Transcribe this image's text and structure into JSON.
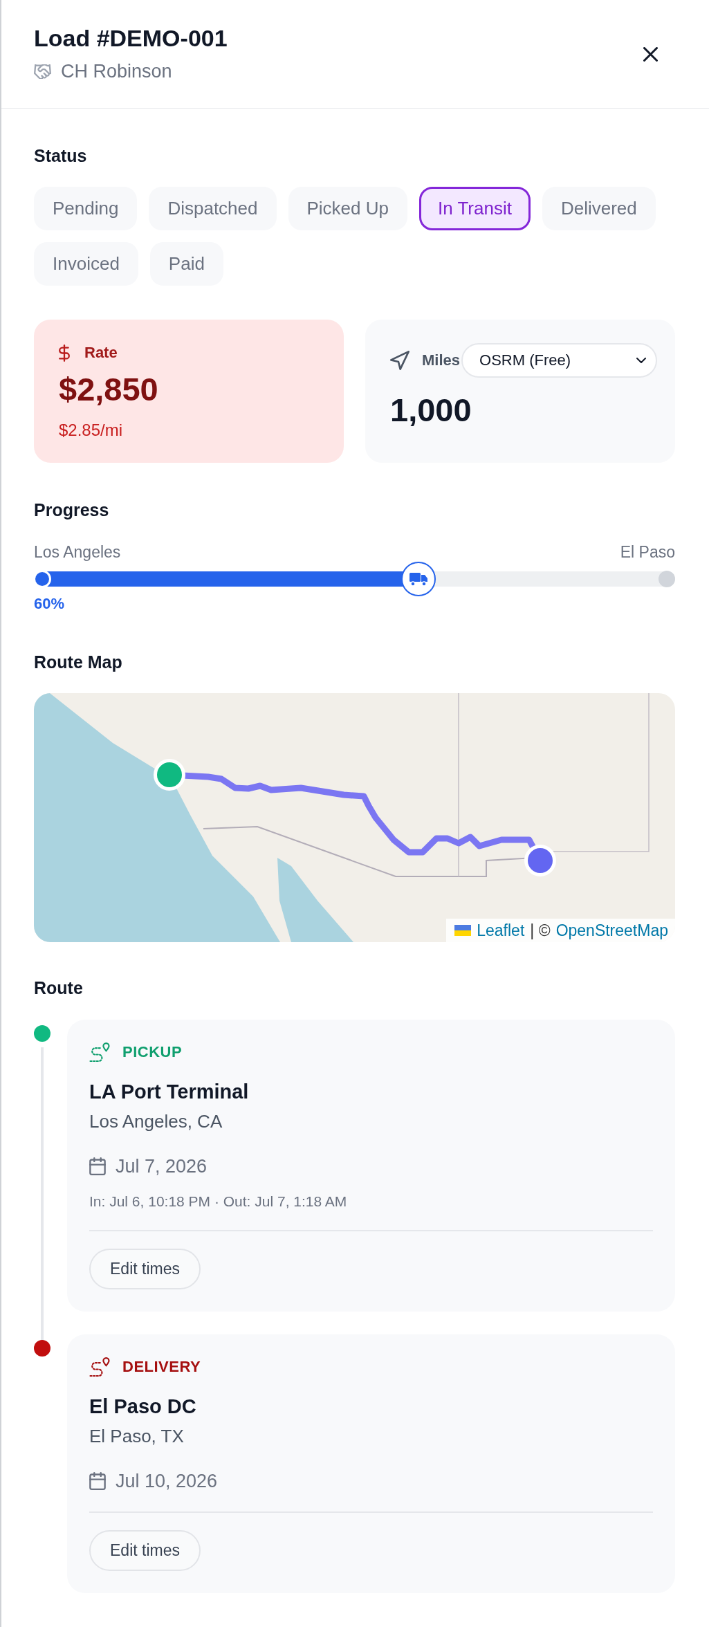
{
  "header": {
    "title": "Load #DEMO-001",
    "customer": "CH Robinson"
  },
  "status": {
    "label": "Status",
    "options": [
      {
        "label": "Pending",
        "selected": false
      },
      {
        "label": "Dispatched",
        "selected": false
      },
      {
        "label": "Picked Up",
        "selected": false
      },
      {
        "label": "In Transit",
        "selected": true
      },
      {
        "label": "Delivered",
        "selected": false
      },
      {
        "label": "Invoiced",
        "selected": false
      },
      {
        "label": "Paid",
        "selected": false
      }
    ]
  },
  "rate": {
    "label": "Rate",
    "amount": "$2,850",
    "per_mile": "$2.85/mi"
  },
  "miles": {
    "label": "Miles",
    "source": {
      "value": "OSRM (Free)"
    },
    "value": "1,000"
  },
  "progress": {
    "label": "Progress",
    "origin": "Los Angeles",
    "destination": "El Paso",
    "level": 0.6,
    "percent": "60%"
  },
  "route_map": {
    "label": "Route Map",
    "attribution": [
      {
        "kind": "link",
        "text": "Leaflet"
      },
      {
        "kind": "text",
        "text": "| ©"
      },
      {
        "kind": "link",
        "text": "OpenStreetMap"
      }
    ]
  },
  "route": {
    "label": "Route",
    "stops": [
      {
        "kind": "pickup",
        "type": "PICKUP",
        "color": "#10b981",
        "name": "LA Port Terminal",
        "location": "Los Angeles, CA",
        "date": "Jul 7, 2026",
        "times": "In: Jul 6, 10:18 PM · Out: Jul 7, 1:18 AM",
        "button": "Edit times"
      },
      {
        "kind": "delivery",
        "type": "DELIVERY",
        "color": "#c10e0e",
        "name": "El Paso DC",
        "location": "El Paso, TX",
        "date": "Jul 10, 2026",
        "button": "Edit times"
      }
    ]
  }
}
